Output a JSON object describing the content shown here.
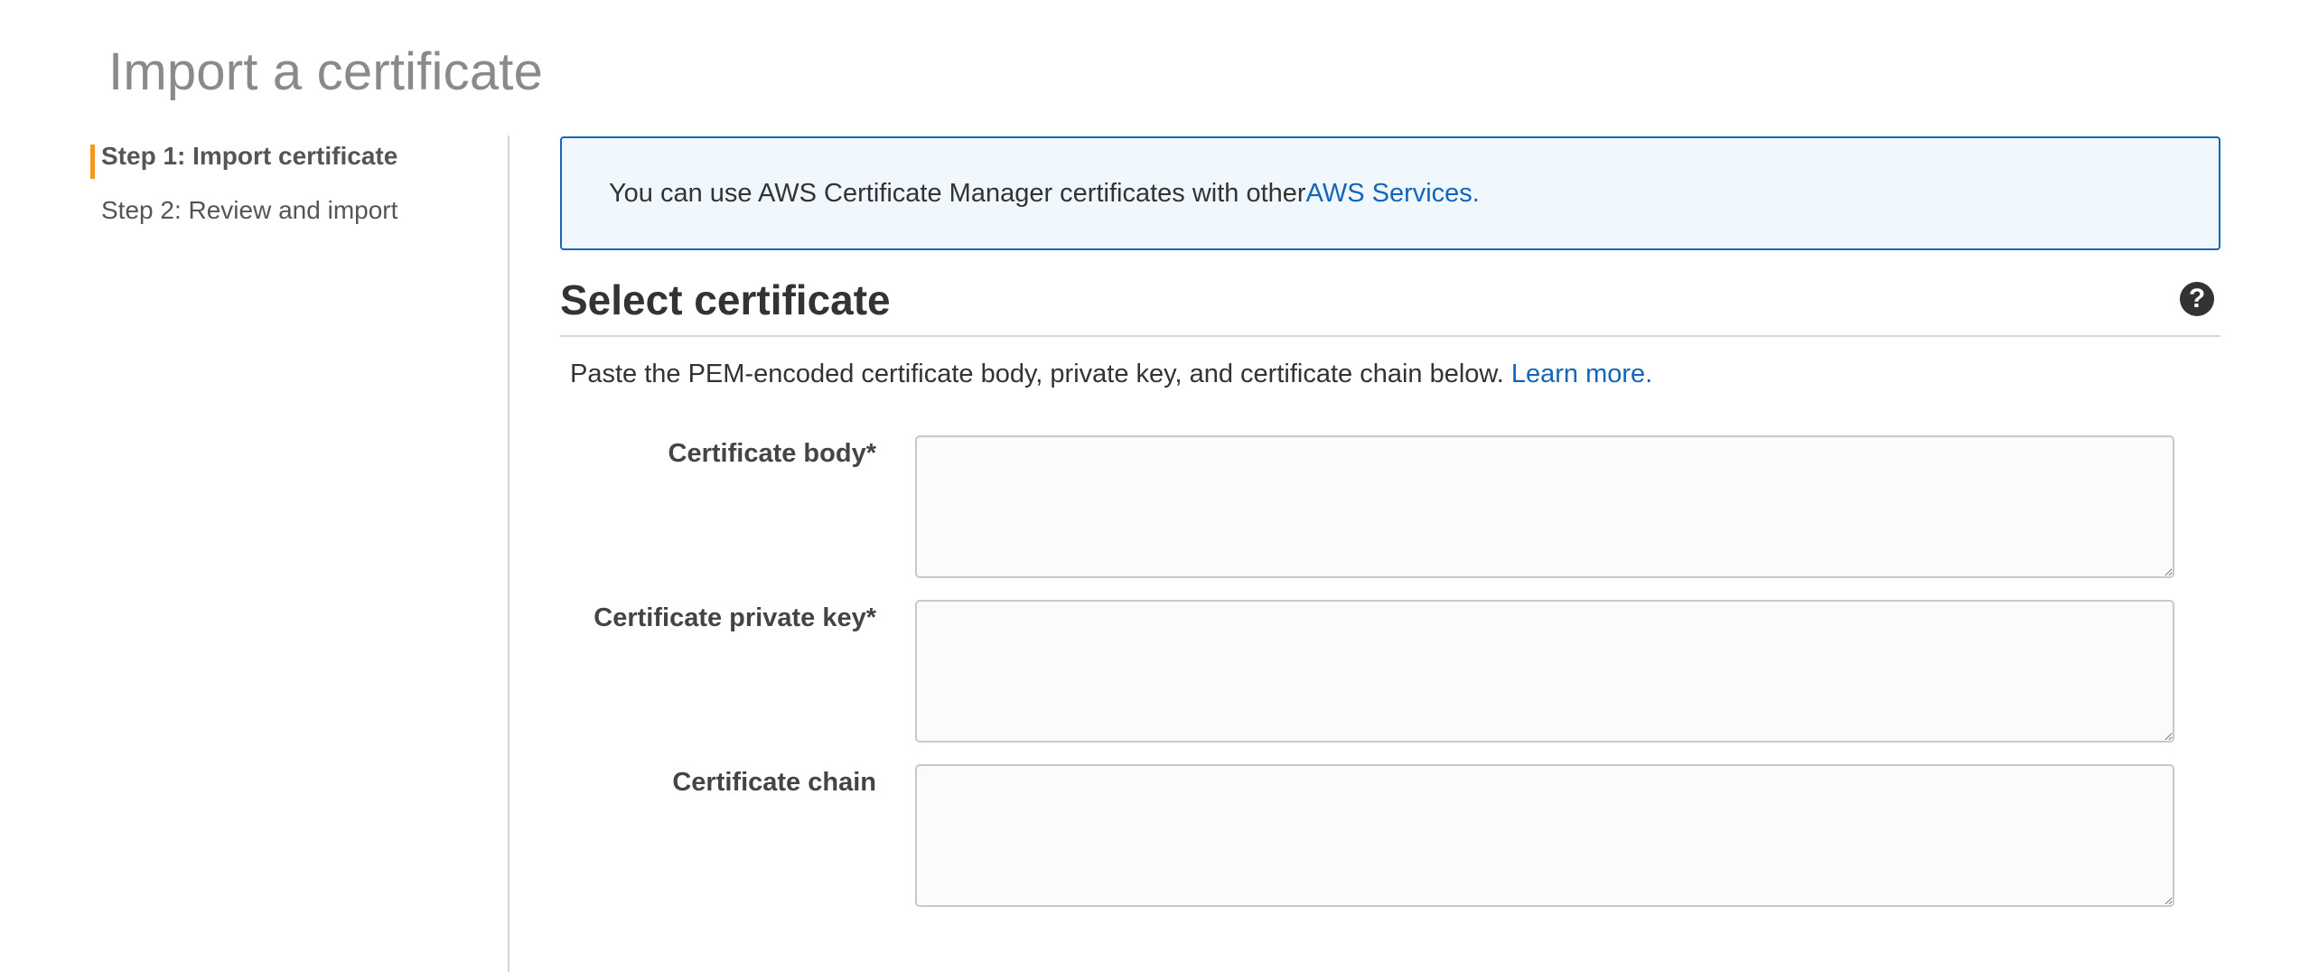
{
  "page": {
    "title": "Import a certificate"
  },
  "steps": [
    {
      "label": "Step 1: Import certificate",
      "active": true
    },
    {
      "label": "Step 2: Review and import",
      "active": false
    }
  ],
  "info": {
    "text": "You can use AWS Certificate Manager certificates with other ",
    "link_label": "AWS Services."
  },
  "section": {
    "title": "Select certificate",
    "help_icon": "question-circle-icon",
    "description": "Paste the PEM-encoded certificate body, private key, and certificate chain below. ",
    "learn_more_label": "Learn more."
  },
  "fields": {
    "body": {
      "label": "Certificate body*",
      "value": "",
      "placeholder": ""
    },
    "private_key": {
      "label": "Certificate private key*",
      "value": "",
      "placeholder": ""
    },
    "chain": {
      "label": "Certificate chain",
      "value": "",
      "placeholder": ""
    }
  },
  "colors": {
    "accent_step": "#f7981d",
    "link": "#1166bb",
    "info_border": "#1866b8",
    "info_background": "#f1f8fd"
  }
}
